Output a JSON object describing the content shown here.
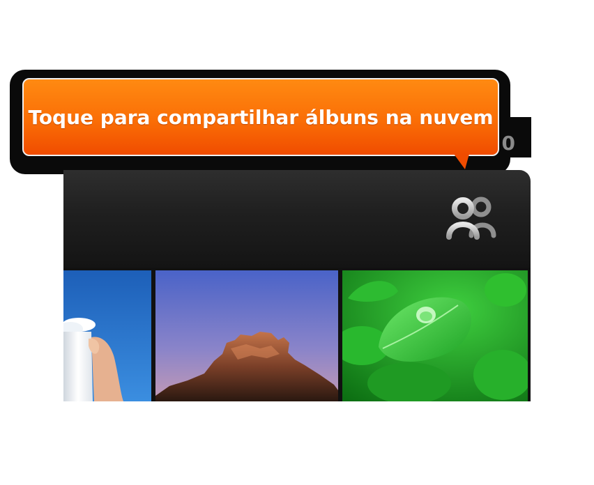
{
  "tooltip": {
    "text": "Toque para compartilhar álbuns na nuvem"
  },
  "partial_text": "0",
  "toolbar": {
    "share_icon": "people-share-icon"
  },
  "gallery": {
    "items": [
      {
        "icon": "photo-cup-sky"
      },
      {
        "icon": "photo-rock-dusk"
      },
      {
        "icon": "photo-leaf-droplet"
      }
    ]
  },
  "colors": {
    "tooltip_top": "#ff8a12",
    "tooltip_bottom": "#f04c00",
    "bar": "#1f1f1f",
    "leaf_green": "#2fc72f"
  }
}
